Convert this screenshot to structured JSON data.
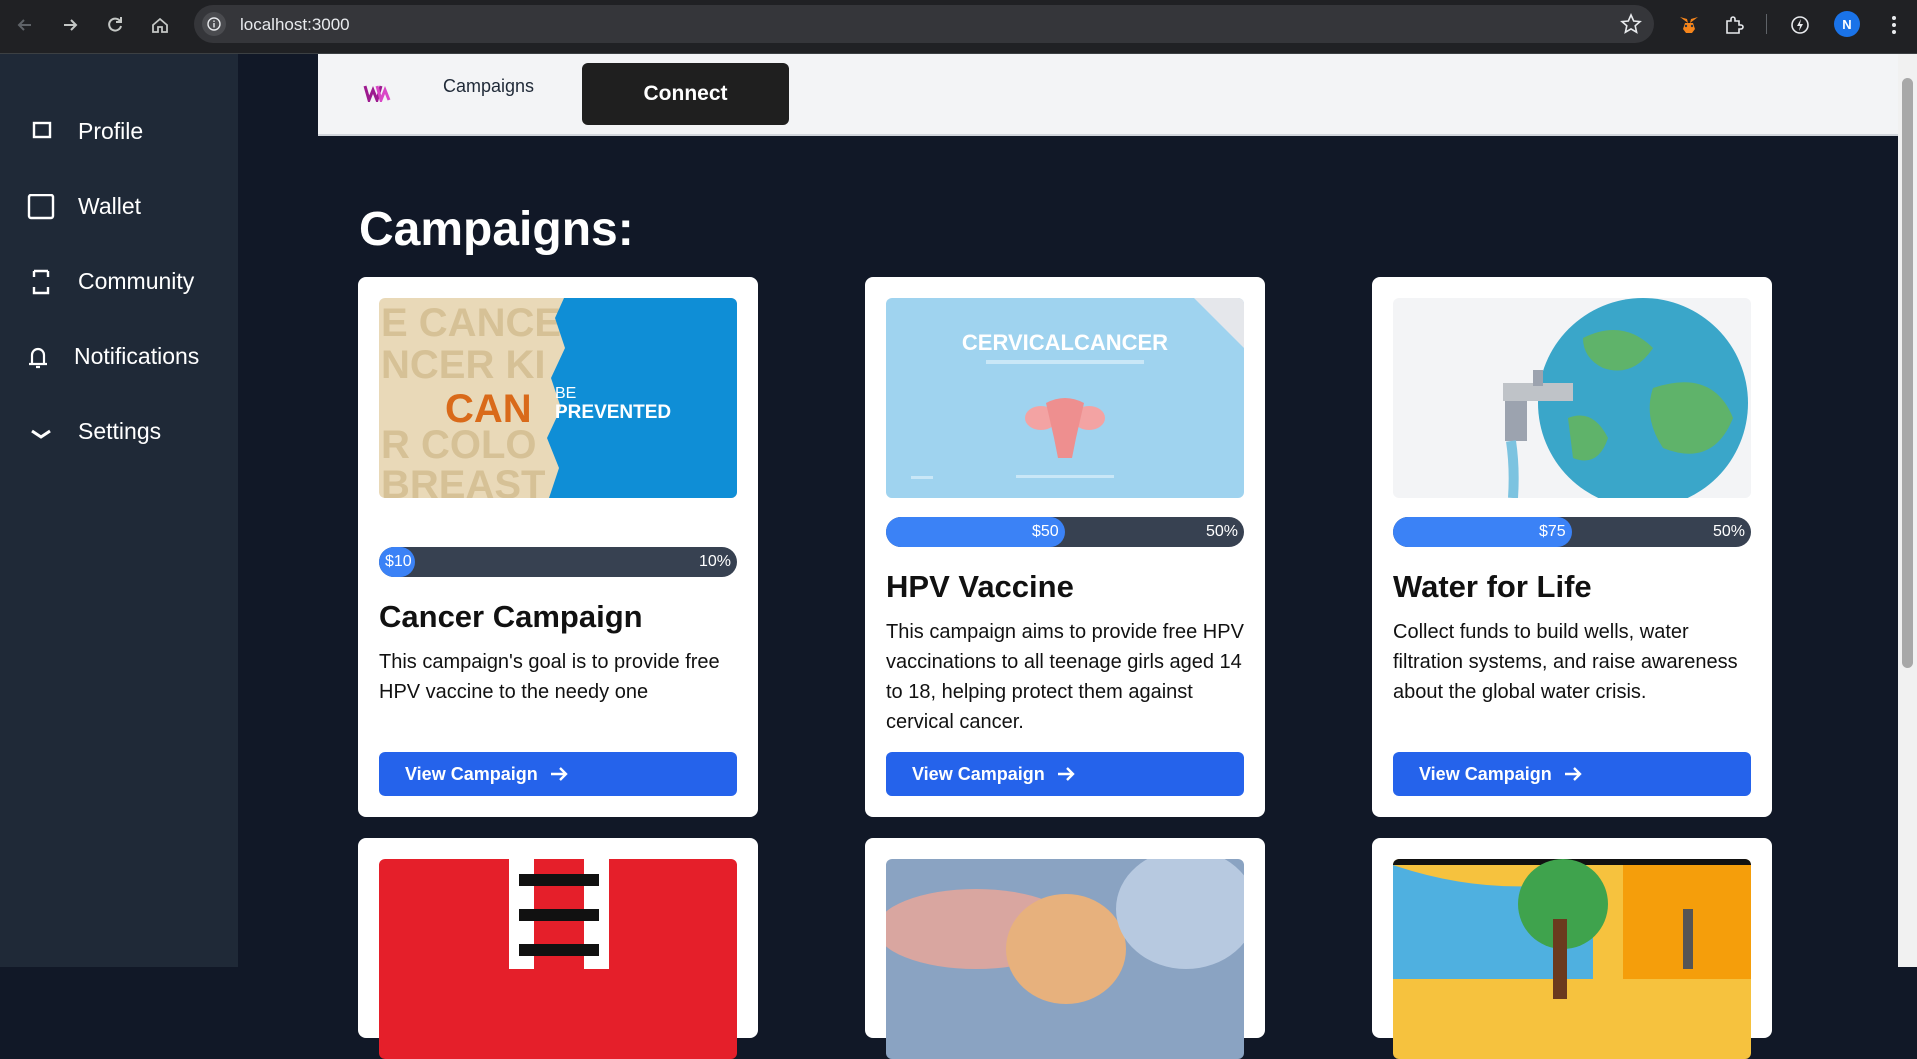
{
  "browser": {
    "url": "localhost:3000",
    "profile_initial": "N"
  },
  "sidebar": {
    "items": [
      {
        "label": "Profile"
      },
      {
        "label": "Wallet"
      },
      {
        "label": "Community"
      },
      {
        "label": "Notifications"
      },
      {
        "label": "Settings"
      }
    ]
  },
  "topbar": {
    "link": "Campaigns",
    "connect_label": "Connect"
  },
  "main": {
    "heading": "Campaigns:",
    "cards": [
      {
        "image_text_main": "CAN",
        "image_text_be": "BE",
        "image_text_prevented": "PREVENTED",
        "amount": "$10",
        "percent": "10%",
        "progress_fraction": 0.1,
        "title": "Cancer Campaign",
        "description": "This campaign's goal is to provide free HPV vaccine to the needy one",
        "button": "View Campaign"
      },
      {
        "image_text_main": "CERVICALCANCER",
        "amount": "$50",
        "percent": "50%",
        "progress_fraction": 0.5,
        "title": "HPV Vaccine",
        "description": "This campaign aims to provide free HPV vaccinations to all teenage girls aged 14 to 18, helping protect them against cervical cancer.",
        "button": "View Campaign"
      },
      {
        "amount": "$75",
        "percent": "50%",
        "progress_fraction": 0.5,
        "title": "Water for Life",
        "description": "Collect funds to build wells, water filtration systems, and raise awareness about the global water crisis.",
        "button": "View Campaign"
      }
    ]
  },
  "colors": {
    "accent": "#2563eb",
    "progress_fill": "#3b82f6",
    "background": "#111827",
    "sidebar": "#1f2937"
  }
}
